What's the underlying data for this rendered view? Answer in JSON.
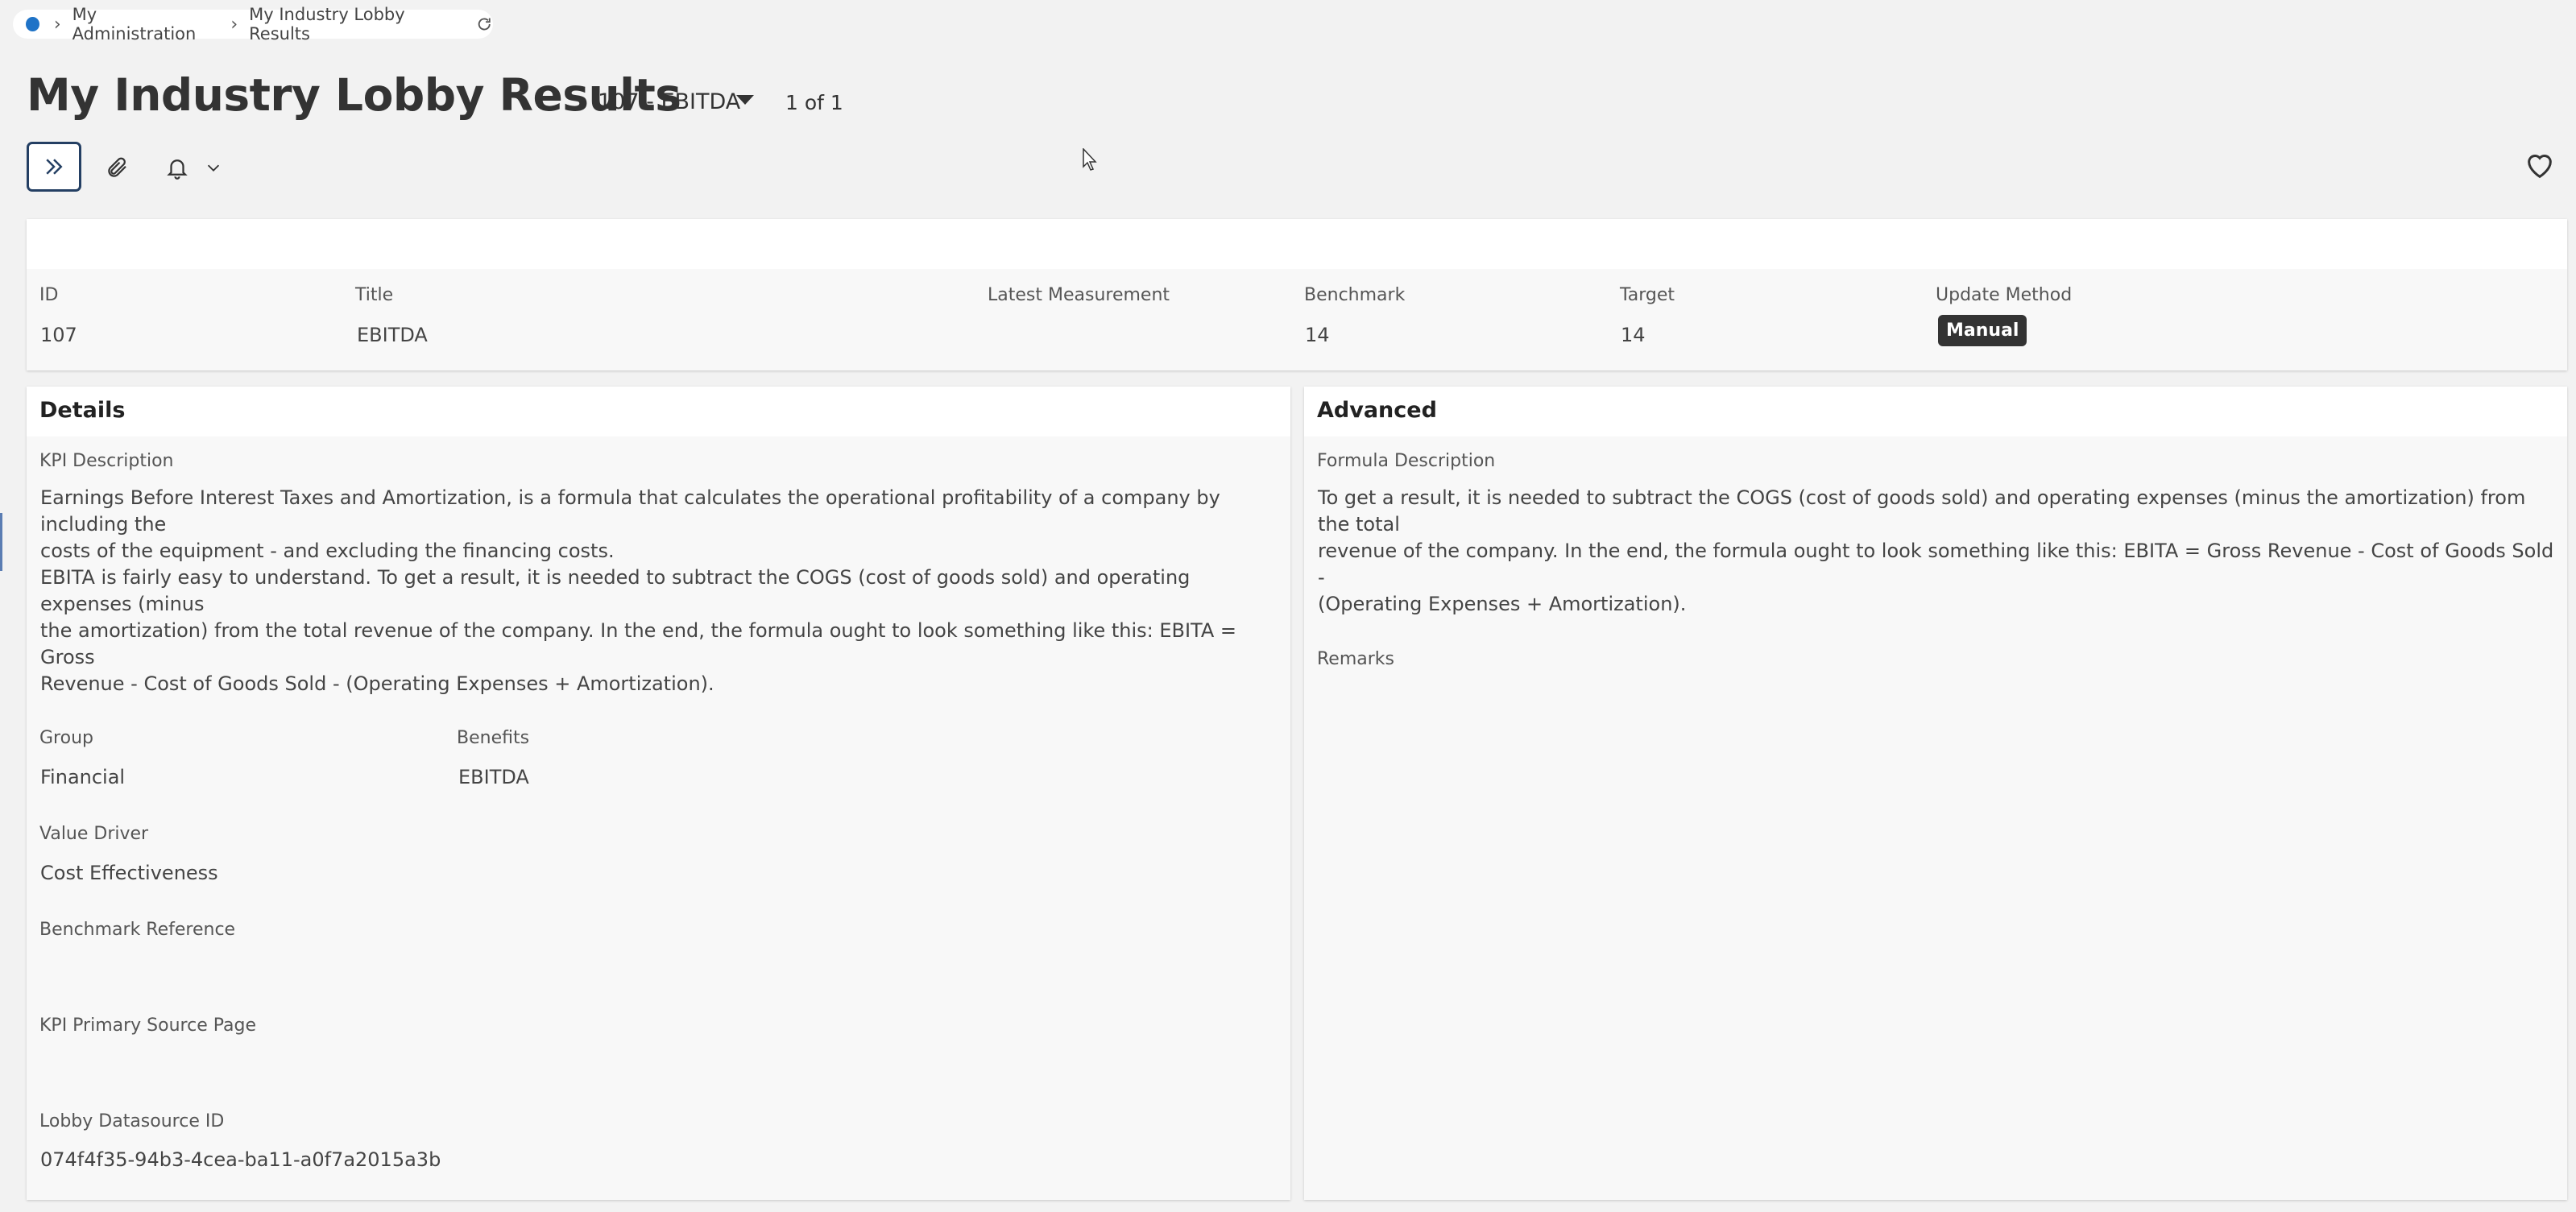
{
  "breadcrumb": {
    "items": [
      "My Administration",
      "My Industry Lobby Results"
    ]
  },
  "header": {
    "title": "My Industry Lobby Results",
    "record_selector": "107 - EBITDA",
    "pager": "1 of 1"
  },
  "toolbar": {
    "icons": [
      "chevrons-right-icon",
      "paperclip-icon",
      "bell-icon",
      "chevron-down-icon",
      "heart-icon"
    ]
  },
  "summary": {
    "columns": {
      "id": {
        "label": "ID",
        "value": "107"
      },
      "title": {
        "label": "Title",
        "value": "EBITDA"
      },
      "latest_measurement": {
        "label": "Latest Measurement",
        "value": ""
      },
      "benchmark": {
        "label": "Benchmark",
        "value": "14"
      },
      "target": {
        "label": "Target",
        "value": "14"
      },
      "update_method": {
        "label": "Update Method",
        "value": "Manual"
      }
    }
  },
  "details": {
    "title": "Details",
    "kpi_description_label": "KPI Description",
    "kpi_description_lines": [
      "Earnings Before Interest Taxes and Amortization, is a formula that calculates the operational profitability of a company by including the",
      "costs of the equipment - and excluding the financing costs.",
      "EBITA is fairly easy to understand. To get a result, it is needed to subtract the COGS (cost of goods sold) and operating expenses (minus",
      "the amortization) from the total revenue of the company. In the end, the formula ought to look something like this: EBITA = Gross",
      "Revenue - Cost of Goods Sold - (Operating Expenses + Amortization)."
    ],
    "group_label": "Group",
    "group_value": "Financial",
    "benefits_label": "Benefits",
    "benefits_value": "EBITDA",
    "value_driver_label": "Value Driver",
    "value_driver_value": "Cost Effectiveness",
    "benchmark_reference_label": "Benchmark Reference",
    "kpi_primary_source_label": "KPI Primary Source Page",
    "lobby_datasource_label": "Lobby Datasource ID",
    "lobby_datasource_value": "074f4f35-94b3-4cea-ba11-a0f7a2015a3b"
  },
  "advanced": {
    "title": "Advanced",
    "formula_label": "Formula Description",
    "formula_lines": [
      "To get a result, it is needed to subtract the COGS (cost of goods sold) and operating expenses (minus the amortization) from the total",
      "revenue of the company. In the end, the formula ought to look something like this: EBITA = Gross Revenue - Cost of Goods Sold -",
      "(Operating Expenses + Amortization)."
    ],
    "remarks_label": "Remarks"
  },
  "colors": {
    "accent_blue": "#1f73c7",
    "badge_bg": "#333333",
    "focus_border": "#243f63",
    "page_bg": "#f2f2f2"
  }
}
